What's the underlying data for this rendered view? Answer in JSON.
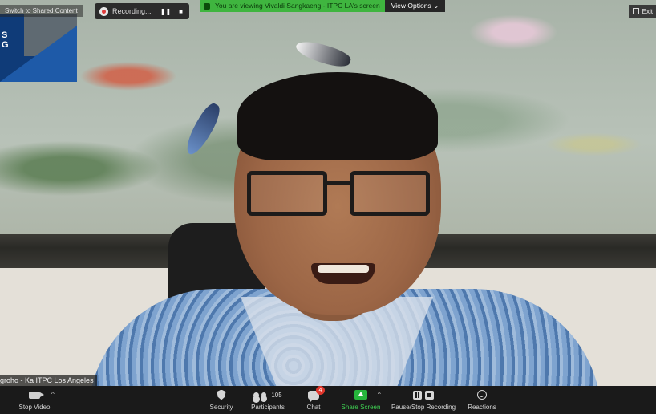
{
  "topbar": {
    "switch_label": "Switch to Shared Content",
    "recording_label": "Recording...",
    "pause_glyph": "❚❚",
    "stop_glyph": "■",
    "viewing_message": "You are viewing Vivaldi Sangkaeng - ITPC LA's screen",
    "view_options_label": "View Options",
    "view_options_caret": "⌄",
    "exit_label": "Exit"
  },
  "thumbnail": {
    "letters": "S\nG"
  },
  "participant": {
    "name_label": "groho - Ka ITPC Los Angeles"
  },
  "toolbar": {
    "stop_video": "Stop Video",
    "security": "Security",
    "participants": "Participants",
    "participant_count": "105",
    "chat": "Chat",
    "chat_badge": "4",
    "share_screen": "Share Screen",
    "recording": "Pause/Stop Recording",
    "reactions": "Reactions",
    "caret": "^"
  },
  "colors": {
    "share_accent": "#3fcf52",
    "viewing_banner": "#3fb53f",
    "badge": "#e0362c"
  }
}
